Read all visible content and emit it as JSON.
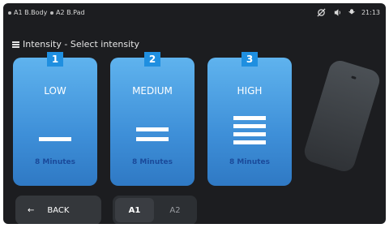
{
  "status_bar": {
    "applicator_1": "A1 B.Body",
    "applicator_2": "A2 B.Pad",
    "icons": [
      "no-link-icon",
      "volume-icon",
      "wifi-icon"
    ],
    "time": "21:13"
  },
  "page": {
    "title": "Intensity  -  Select intensity"
  },
  "cards": [
    {
      "badge": "1",
      "label": "LOW",
      "minutes": "8 Minutes",
      "level": 1
    },
    {
      "badge": "2",
      "label": "MEDIUM",
      "minutes": "8 Minutes",
      "level": 2
    },
    {
      "badge": "3",
      "label": "HIGH",
      "minutes": "8 Minutes",
      "level": 3
    }
  ],
  "back_button": {
    "arrow": "←",
    "label": "BACK"
  },
  "applicator_toggle": {
    "options": [
      "A1",
      "A2"
    ],
    "selected": "A1"
  },
  "colors": {
    "card_top": "#5fb3ee",
    "card_bottom": "#2f79c4",
    "badge": "#1f8fe0",
    "background": "#1c1d20"
  }
}
